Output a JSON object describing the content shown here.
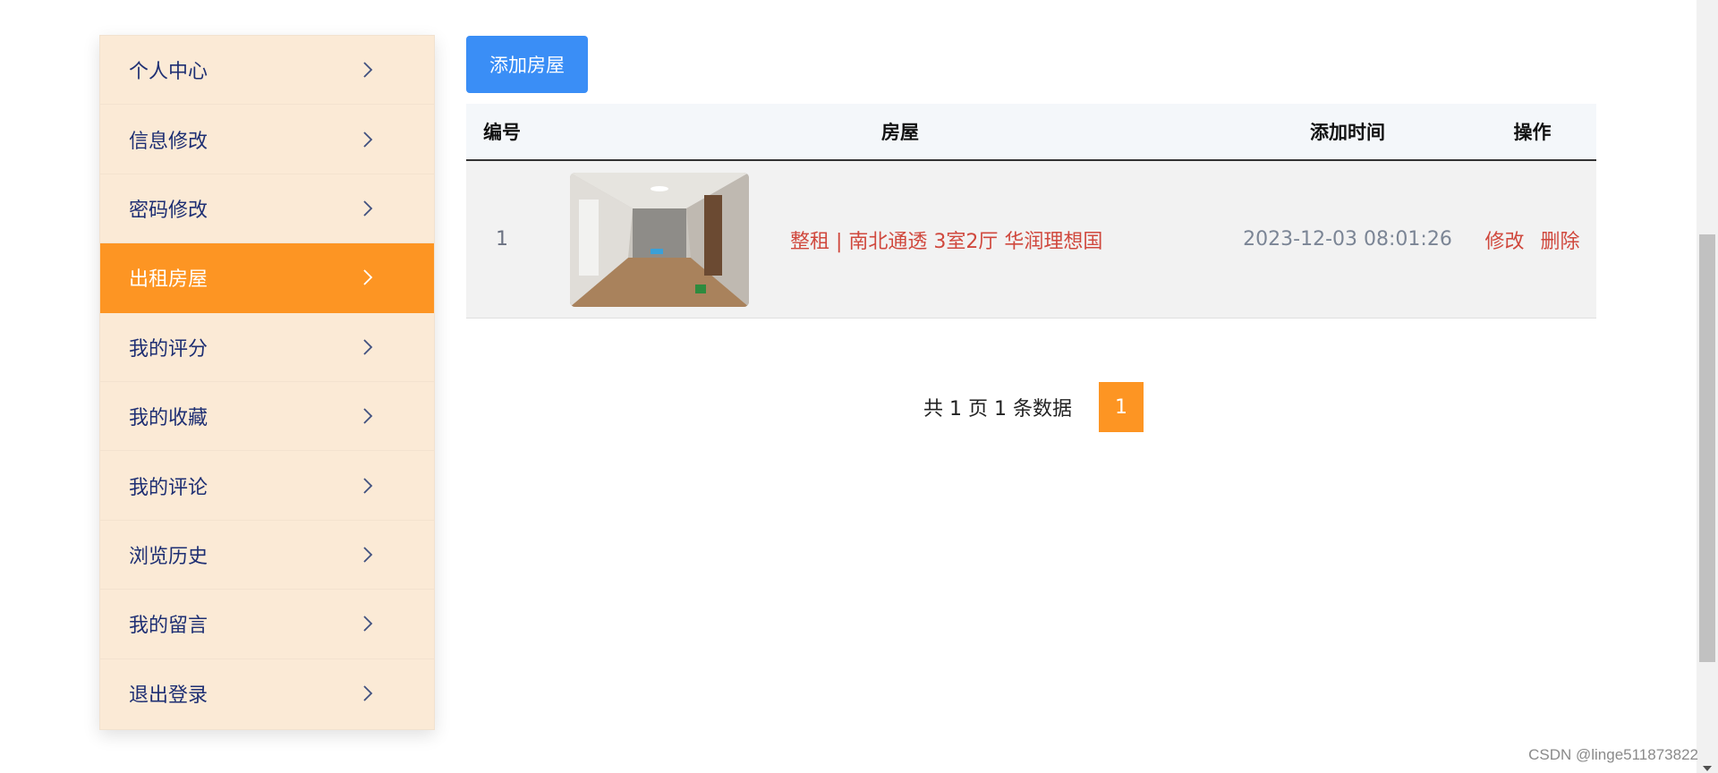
{
  "sidebar": {
    "items": [
      {
        "label": "个人中心",
        "active": false
      },
      {
        "label": "信息修改",
        "active": false
      },
      {
        "label": "密码修改",
        "active": false
      },
      {
        "label": "出租房屋",
        "active": true
      },
      {
        "label": "我的评分",
        "active": false
      },
      {
        "label": "我的收藏",
        "active": false
      },
      {
        "label": "我的评论",
        "active": false
      },
      {
        "label": "浏览历史",
        "active": false
      },
      {
        "label": "我的留言",
        "active": false
      },
      {
        "label": "退出登录",
        "active": false
      }
    ]
  },
  "toolbar": {
    "add_label": "添加房屋"
  },
  "table": {
    "headers": {
      "no": "编号",
      "house": "房屋",
      "time": "添加时间",
      "ops": "操作"
    },
    "rows": [
      {
        "no": "1",
        "title": "整租 | 南北通透 3室2厅 华润理想国",
        "time": "2023-12-03 08:01:26",
        "edit": "修改",
        "delete": "删除"
      }
    ]
  },
  "pagination": {
    "info": "共 1 页 1 条数据",
    "current": "1"
  },
  "watermark": "CSDN @linge511873822",
  "colors": {
    "accent": "#fd9523",
    "primary": "#3a8ef6",
    "link": "#d0483d",
    "sidebar_bg": "#fbead6"
  }
}
